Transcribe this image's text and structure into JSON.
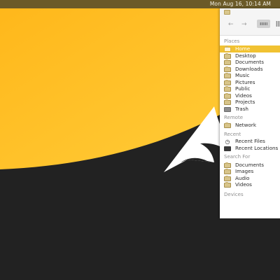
{
  "top_bar": {
    "clock": "Mon Aug 16, 10:14 AM"
  },
  "file_manager": {
    "toolbar": {
      "back_glyph": "←",
      "forward_glyph": "→"
    },
    "sections": {
      "places": "Places",
      "remote": "Remote",
      "recent": "Recent",
      "search_for": "Search For",
      "devices": "Devices"
    },
    "places": [
      {
        "label": "Home",
        "icon": "home-folder-icon",
        "selected": true
      },
      {
        "label": "Desktop",
        "icon": "folder-icon"
      },
      {
        "label": "Documents",
        "icon": "folder-icon"
      },
      {
        "label": "Downloads",
        "icon": "folder-icon"
      },
      {
        "label": "Music",
        "icon": "folder-icon"
      },
      {
        "label": "Pictures",
        "icon": "folder-icon"
      },
      {
        "label": "Public",
        "icon": "folder-icon"
      },
      {
        "label": "Videos",
        "icon": "folder-icon"
      },
      {
        "label": "Projects",
        "icon": "folder-icon"
      },
      {
        "label": "Trash",
        "icon": "trash-icon"
      }
    ],
    "remote": [
      {
        "label": "Network",
        "icon": "folder-icon"
      }
    ],
    "recent": [
      {
        "label": "Recent Files",
        "icon": "clock-icon"
      },
      {
        "label": "Recent Locations",
        "icon": "server-icon"
      }
    ],
    "search_for": [
      {
        "label": "Documents",
        "icon": "folder-icon"
      },
      {
        "label": "Images",
        "icon": "folder-icon"
      },
      {
        "label": "Audio",
        "icon": "folder-icon"
      },
      {
        "label": "Videos",
        "icon": "folder-icon"
      }
    ]
  },
  "colors": {
    "wallpaper_yellow": "#ffc122",
    "wallpaper_dark": "#222222",
    "selection": "#f1c232",
    "top_bar": "#6b5a28"
  }
}
